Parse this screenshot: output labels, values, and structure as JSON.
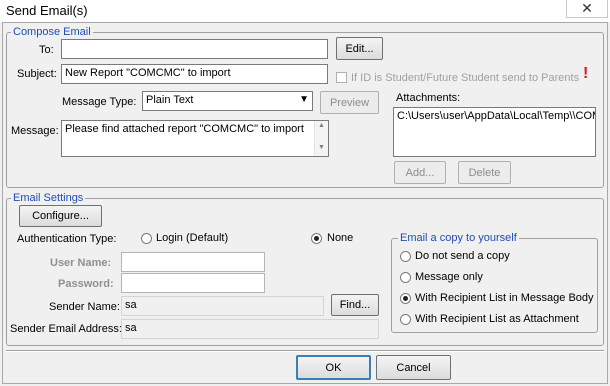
{
  "window": {
    "title": "Send Email(s)",
    "close_glyph": "✕"
  },
  "compose": {
    "legend": "Compose Email",
    "to_label": "To:",
    "to_value": "",
    "edit_button": "Edit...",
    "subject_label": "Subject:",
    "subject_value": "New Report \"COMCMC\" to import",
    "student_checkbox_label": "If ID is Student/Future Student send to Parents",
    "student_checkbox_checked": false,
    "warning_glyph": "!",
    "message_type_label": "Message Type:",
    "message_type_value": "Plain Text",
    "preview_button": "Preview",
    "message_label": "Message:",
    "message_value": "Please find attached report \"COMCMC\" to import",
    "attachments_label": "Attachments:",
    "attachments": [
      "C:\\Users\\user\\AppData\\Local\\Temp\\\\COM"
    ],
    "add_button": "Add...",
    "delete_button": "Delete"
  },
  "email_settings": {
    "legend": "Email Settings",
    "configure_button": "Configure...",
    "auth_type_label": "Authentication Type:",
    "auth_options": [
      {
        "label": "Login (Default)",
        "selected": false
      },
      {
        "label": "None",
        "selected": true
      }
    ],
    "user_name_label": "User Name:",
    "user_name_value": "",
    "password_label": "Password:",
    "password_value": "",
    "sender_name_label": "Sender Name:",
    "sender_name_value": "sa",
    "find_button": "Find...",
    "sender_email_label": "Sender Email Address:",
    "sender_email_value": "sa"
  },
  "copy_group": {
    "legend": "Email a copy to yourself",
    "options": [
      {
        "label": "Do not send a copy",
        "selected": false
      },
      {
        "label": "Message only",
        "selected": false
      },
      {
        "label": "With Recipient List in Message Body",
        "selected": true
      },
      {
        "label": "With Recipient List as Attachment",
        "selected": false
      }
    ]
  },
  "footer": {
    "ok_button": "OK",
    "cancel_button": "Cancel"
  },
  "colors": {
    "legend_text": "#1f4eb4",
    "warning": "#e0141e",
    "dialog_bg": "#f0f0f0"
  }
}
